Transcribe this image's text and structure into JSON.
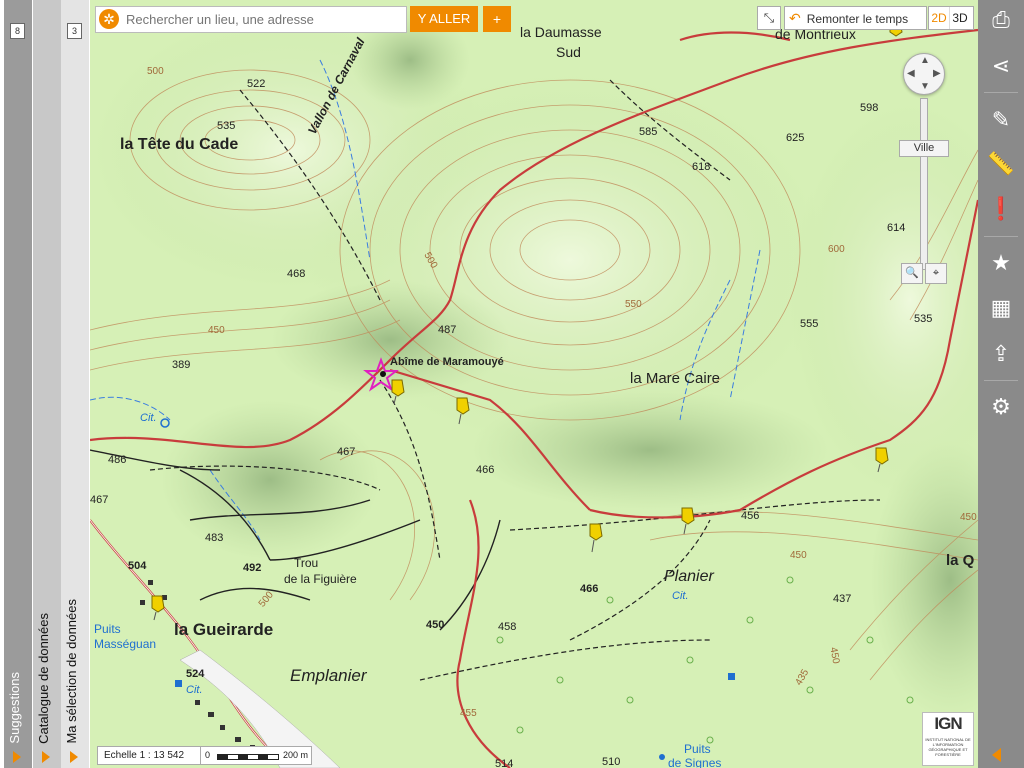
{
  "left_tabs": [
    {
      "label": "Suggestions",
      "count": "8"
    },
    {
      "label": "Catalogue de données",
      "count": ""
    },
    {
      "label": "Ma sélection de données",
      "count": "3"
    }
  ],
  "search": {
    "placeholder": "Rechercher un lieu, une adresse",
    "go_label": "Y ALLER",
    "plus_label": "+"
  },
  "top_controls": {
    "time_label": "Remonter le temps",
    "dim_2d": "2D",
    "dim_3d": "3D",
    "zoom_label": "Ville"
  },
  "map_labels": {
    "place_names": [
      "la Tête du Cade",
      "Vallon de Carnaval",
      "la Daumasse",
      "Sud",
      "de Montrieux",
      "Abîme de Maramouyé",
      "la Mare Caire",
      "Planier",
      "la Gueirarde",
      "Emplanier",
      "Trou",
      "de la Figuière",
      "Puits",
      "Masséguan",
      "Puits",
      "de Signes",
      "la Q"
    ],
    "elevations": [
      "522",
      "535",
      "468",
      "487",
      "389",
      "486",
      "467",
      "483",
      "504",
      "492",
      "466",
      "467",
      "450",
      "458",
      "466",
      "456",
      "437",
      "585",
      "618",
      "625",
      "598",
      "614",
      "535",
      "555",
      "524",
      "510",
      "514"
    ],
    "contour_values": [
      "500",
      "450",
      "550",
      "600",
      "500",
      "450",
      "500",
      "450",
      "435",
      "455",
      "450"
    ],
    "misc": [
      "Cit.",
      "Cit.",
      "Cit."
    ]
  },
  "scale": {
    "ratio_text": "Echelle 1 : 13 542",
    "bar_zero": "0",
    "bar_end": "200 m"
  },
  "right_toolbar": {
    "icons": [
      "printer-icon",
      "share-icon",
      "pencil-icon",
      "ruler-icon",
      "alert-icon",
      "star-icon",
      "map-icon",
      "import-icon",
      "gear-icon"
    ]
  },
  "ign": {
    "logo": "IGN",
    "subtitle": "INSTITUT NATIONAL DE L'INFORMATION GÉOGRAPHIQUE ET FORESTIÈRE"
  },
  "colors": {
    "accent": "#f08a00",
    "map_bg": "#d6f0b6",
    "road": "#c83c3c",
    "contour": "#c08a5a"
  }
}
